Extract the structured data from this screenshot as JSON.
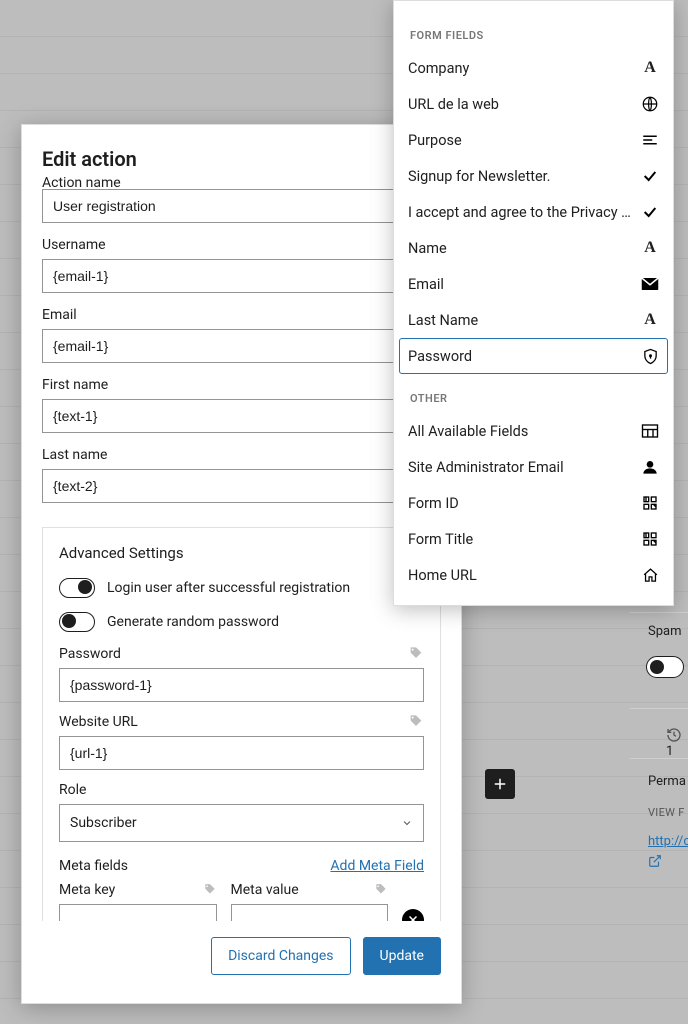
{
  "modal": {
    "title": "Edit action",
    "action_name_label": "Action name",
    "action_name_value": "User registration",
    "username_label": "Username",
    "username_value": "{email-1}",
    "email_label": "Email",
    "email_value": "{email-1}",
    "first_name_label": "First name",
    "first_name_value": "{text-1}",
    "last_name_label": "Last name",
    "last_name_value": "{text-2}",
    "advanced_title": "Advanced Settings",
    "toggle_login_label": "Login user after successful registration",
    "toggle_random_pw_label": "Generate random password",
    "password_label": "Password",
    "password_value": "{password-1}",
    "website_label": "Website URL",
    "website_value": "{url-1}",
    "role_label": "Role",
    "role_value": "Subscriber",
    "meta_fields_label": "Meta fields",
    "add_meta_link": "Add Meta Field",
    "meta_key_label": "Meta key",
    "meta_value_label": "Meta value",
    "discard_label": "Discard Changes",
    "update_label": "Update"
  },
  "dropdown": {
    "section_form_fields": "FORM FIELDS",
    "section_other": "OTHER",
    "form_fields": [
      {
        "label": "Company",
        "icon": "letter-a"
      },
      {
        "label": "URL de la web",
        "icon": "globe"
      },
      {
        "label": "Purpose",
        "icon": "lines"
      },
      {
        "label": "Signup for Newsletter.",
        "icon": "check"
      },
      {
        "label": "I accept and agree to the Privacy Pol...",
        "icon": "check"
      },
      {
        "label": "Name",
        "icon": "letter-a"
      },
      {
        "label": "Email",
        "icon": "mail"
      },
      {
        "label": "Last Name",
        "icon": "letter-a"
      },
      {
        "label": "Password",
        "icon": "shield",
        "selected": true
      }
    ],
    "other": [
      {
        "label": "All Available Fields",
        "icon": "table"
      },
      {
        "label": "Site Administrator Email",
        "icon": "user"
      },
      {
        "label": "Form ID",
        "icon": "qr"
      },
      {
        "label": "Form Title",
        "icon": "qr"
      },
      {
        "label": "Home URL",
        "icon": "home"
      }
    ]
  },
  "right_peek": {
    "spam": "Spam",
    "revision": "1",
    "perma": "Perma",
    "view": "VIEW F",
    "link": "http://c"
  }
}
